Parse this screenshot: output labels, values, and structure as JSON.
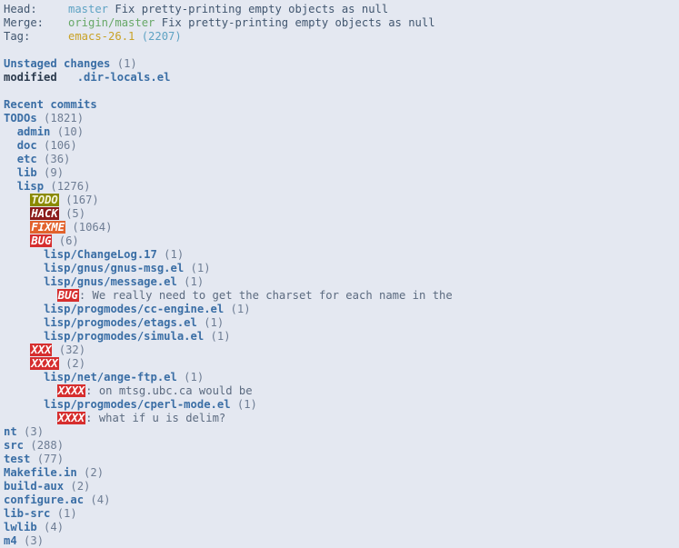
{
  "buffer": {
    "name": "magit-status",
    "background": "#e4e8f1",
    "foreground": "#41566f"
  },
  "header": {
    "rows": [
      {
        "label": "Head:",
        "value": "master",
        "value_kind": "branch",
        "message": "Fix pretty-printing empty objects as null"
      },
      {
        "label": "Merge:",
        "value": "origin/master",
        "value_kind": "remote",
        "message": "Fix pretty-printing empty objects as null"
      },
      {
        "label": "Tag:",
        "value": "emacs-26.1",
        "value_kind": "tag",
        "count": "(2207)"
      }
    ]
  },
  "unstaged": {
    "heading": "Unstaged changes",
    "count": "(1)",
    "files": [
      {
        "status": "modified",
        "name": ".dir-locals.el"
      }
    ]
  },
  "recent_commits": {
    "heading": "Recent commits"
  },
  "todos": {
    "heading": "TODOs",
    "count": "(1821)",
    "rows": [
      {
        "indent": 1,
        "kind": "node",
        "label": "admin",
        "count": "(10)"
      },
      {
        "indent": 1,
        "kind": "node",
        "label": "doc",
        "count": "(106)"
      },
      {
        "indent": 1,
        "kind": "node",
        "label": "etc",
        "count": "(36)"
      },
      {
        "indent": 1,
        "kind": "node",
        "label": "lib",
        "count": "(9)"
      },
      {
        "indent": 1,
        "kind": "node",
        "label": "lisp",
        "count": "(1276)"
      },
      {
        "indent": 2,
        "kind": "keyword",
        "keyword": "TODO",
        "badge": "todo",
        "count": "(167)"
      },
      {
        "indent": 2,
        "kind": "keyword",
        "keyword": "HACK",
        "badge": "hack",
        "count": "(5)"
      },
      {
        "indent": 2,
        "kind": "keyword",
        "keyword": "FIXME",
        "badge": "fixme",
        "count": "(1064)"
      },
      {
        "indent": 2,
        "kind": "keyword",
        "keyword": "BUG",
        "badge": "bug",
        "count": "(6)"
      },
      {
        "indent": 3,
        "kind": "node",
        "label": "lisp/ChangeLog.17",
        "count": "(1)"
      },
      {
        "indent": 3,
        "kind": "node",
        "label": "lisp/gnus/gnus-msg.el",
        "count": "(1)"
      },
      {
        "indent": 3,
        "kind": "node",
        "label": "lisp/gnus/message.el",
        "count": "(1)"
      },
      {
        "indent": 4,
        "kind": "comment",
        "keyword": "BUG",
        "badge": "bug",
        "text": ": We really need to get the charset for each name in the"
      },
      {
        "indent": 3,
        "kind": "node",
        "label": "lisp/progmodes/cc-engine.el",
        "count": "(1)"
      },
      {
        "indent": 3,
        "kind": "node",
        "label": "lisp/progmodes/etags.el",
        "count": "(1)"
      },
      {
        "indent": 3,
        "kind": "node",
        "label": "lisp/progmodes/simula.el",
        "count": "(1)"
      },
      {
        "indent": 2,
        "kind": "keyword",
        "keyword": "XXX",
        "badge": "xxx",
        "count": "(32)"
      },
      {
        "indent": 2,
        "kind": "keyword",
        "keyword": "XXXX",
        "badge": "xxx",
        "count": "(2)"
      },
      {
        "indent": 3,
        "kind": "node",
        "label": "lisp/net/ange-ftp.el",
        "count": "(1)"
      },
      {
        "indent": 4,
        "kind": "comment",
        "keyword": "XXXX",
        "badge": "xxx",
        "text": ": on mtsg.ubc.ca would be"
      },
      {
        "indent": 3,
        "kind": "node",
        "label": "lisp/progmodes/cperl-mode.el",
        "count": "(1)"
      },
      {
        "indent": 4,
        "kind": "comment",
        "keyword": "XXXX",
        "badge": "xxx",
        "text": ": what if u is delim?"
      },
      {
        "indent": 0,
        "kind": "node",
        "label": "nt",
        "count": "(3)"
      },
      {
        "indent": 0,
        "kind": "node",
        "label": "src",
        "count": "(288)"
      },
      {
        "indent": 0,
        "kind": "node",
        "label": "test",
        "count": "(77)"
      },
      {
        "indent": 0,
        "kind": "node",
        "label": "Makefile.in",
        "count": "(2)"
      },
      {
        "indent": 0,
        "kind": "node",
        "label": "build-aux",
        "count": "(2)"
      },
      {
        "indent": 0,
        "kind": "node",
        "label": "configure.ac",
        "count": "(4)"
      },
      {
        "indent": 0,
        "kind": "node",
        "label": "lib-src",
        "count": "(1)"
      },
      {
        "indent": 0,
        "kind": "node",
        "label": "lwlib",
        "count": "(4)"
      },
      {
        "indent": 0,
        "kind": "node",
        "label": "m4",
        "count": "(3)"
      }
    ]
  },
  "colors": {
    "todo_badge": "#8a8a00",
    "hack_badge": "#8b1a1a",
    "fixme_badge": "#e2622c",
    "bug_badge": "#d62e2e",
    "xxx_badge": "#d62e2e",
    "section_heading": "#3a6ea5",
    "branch": "#5fa3c4",
    "remote": "#68a868",
    "tag": "#c9a227"
  }
}
